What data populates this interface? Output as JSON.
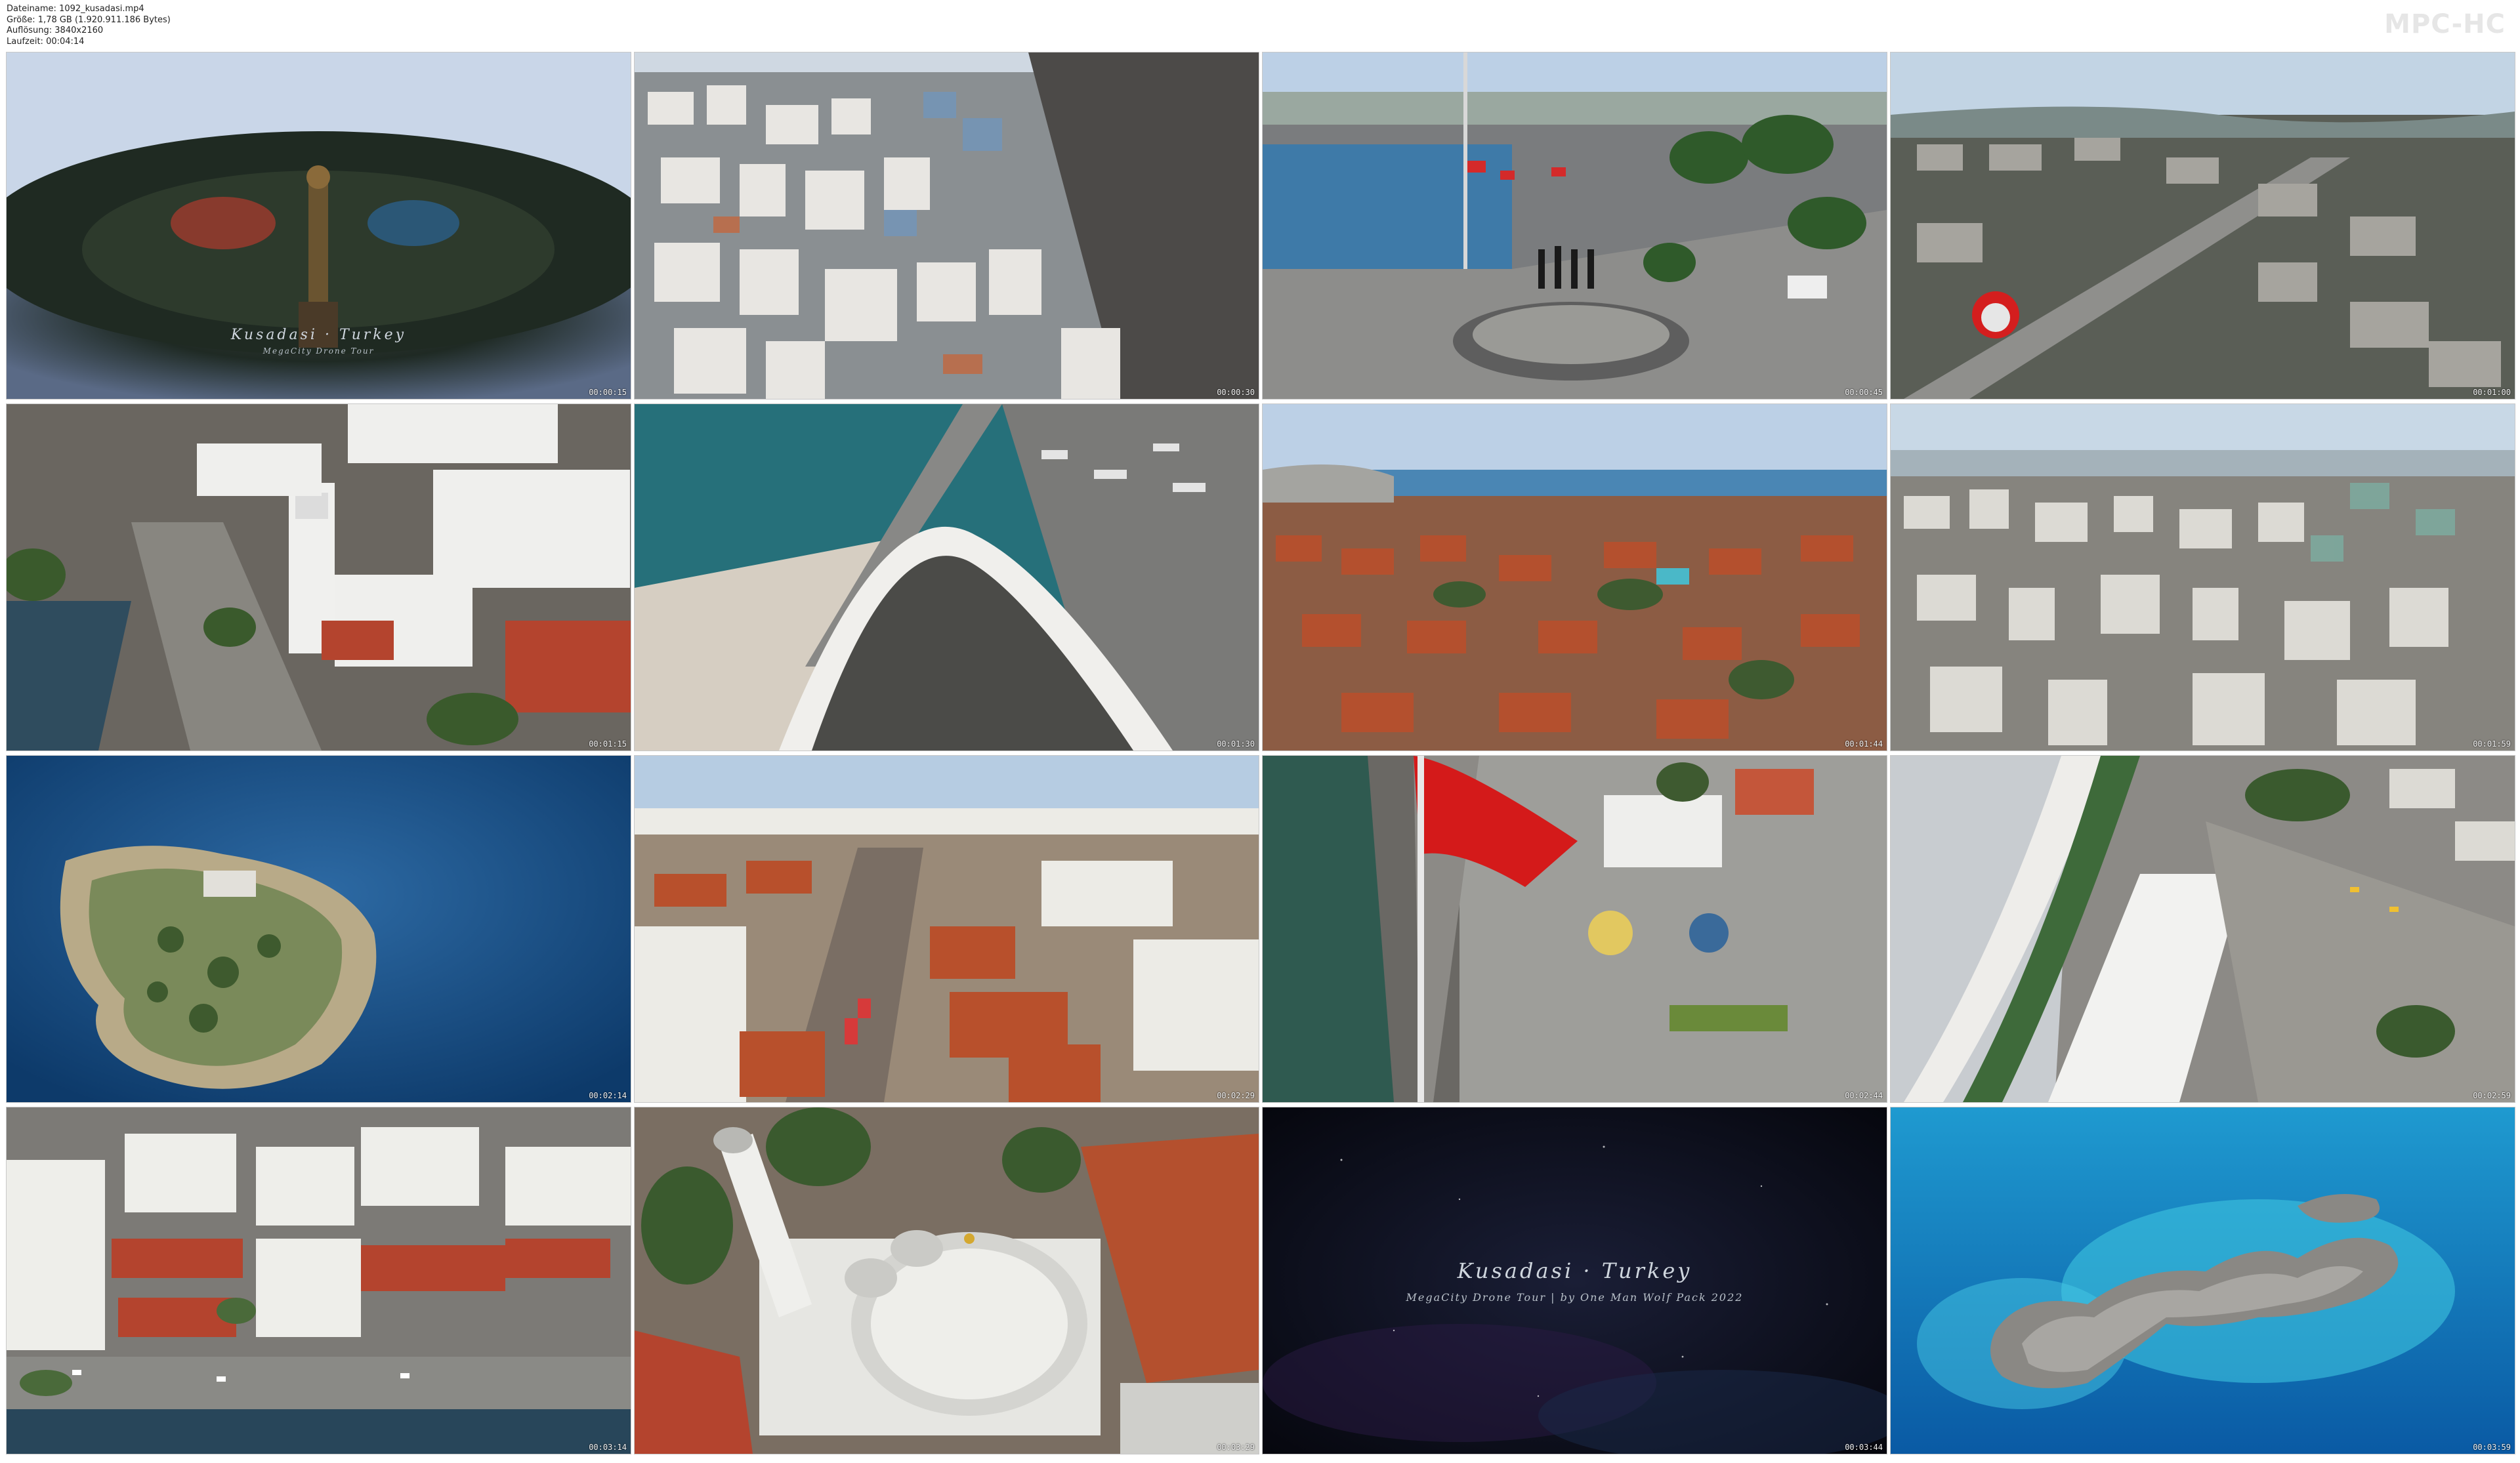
{
  "file_info": {
    "filename": "Dateiname: 1092_kusadasi.mp4",
    "size": "Größe: 1,78 GB (1.920.911.186 Bytes)",
    "resolution": "Auflösung: 3840x2160",
    "duration": "Laufzeit: 00:04:14"
  },
  "player_brand": "MPC-HC",
  "thumbnails": [
    {
      "timestamp": "00:00:15",
      "scene": "statue-intro-title",
      "overlay_title": "Kusadasi · Turkey",
      "overlay_sub": "MegaCity Drone Tour"
    },
    {
      "timestamp": "00:00:30",
      "scene": "hillside-city-aerial"
    },
    {
      "timestamp": "00:00:45",
      "scene": "waterfront-plaza-flags"
    },
    {
      "timestamp": "00:01:00",
      "scene": "highway-suburbs"
    },
    {
      "timestamp": "00:01:15",
      "scene": "clock-tower-street"
    },
    {
      "timestamp": "00:01:30",
      "scene": "curved-pier-marina"
    },
    {
      "timestamp": "00:01:44",
      "scene": "bay-panorama"
    },
    {
      "timestamp": "00:01:59",
      "scene": "colorful-hill-town"
    },
    {
      "timestamp": "00:02:14",
      "scene": "pigeon-island-aerial"
    },
    {
      "timestamp": "00:02:29",
      "scene": "old-town-street"
    },
    {
      "timestamp": "00:02:44",
      "scene": "turkish-flag-pier"
    },
    {
      "timestamp": "00:02:59",
      "scene": "marina-walkway"
    },
    {
      "timestamp": "00:03:14",
      "scene": "seafront-buildings"
    },
    {
      "timestamp": "00:03:29",
      "scene": "mosque-dome-minaret"
    },
    {
      "timestamp": "00:03:44",
      "scene": "end-title-card",
      "overlay_title": "Kusadasi · Turkey",
      "overlay_sub": "MegaCity Drone Tour | by One Man Wolf Pack 2022"
    },
    {
      "timestamp": "00:03:59",
      "scene": "turquoise-rock-island"
    }
  ]
}
